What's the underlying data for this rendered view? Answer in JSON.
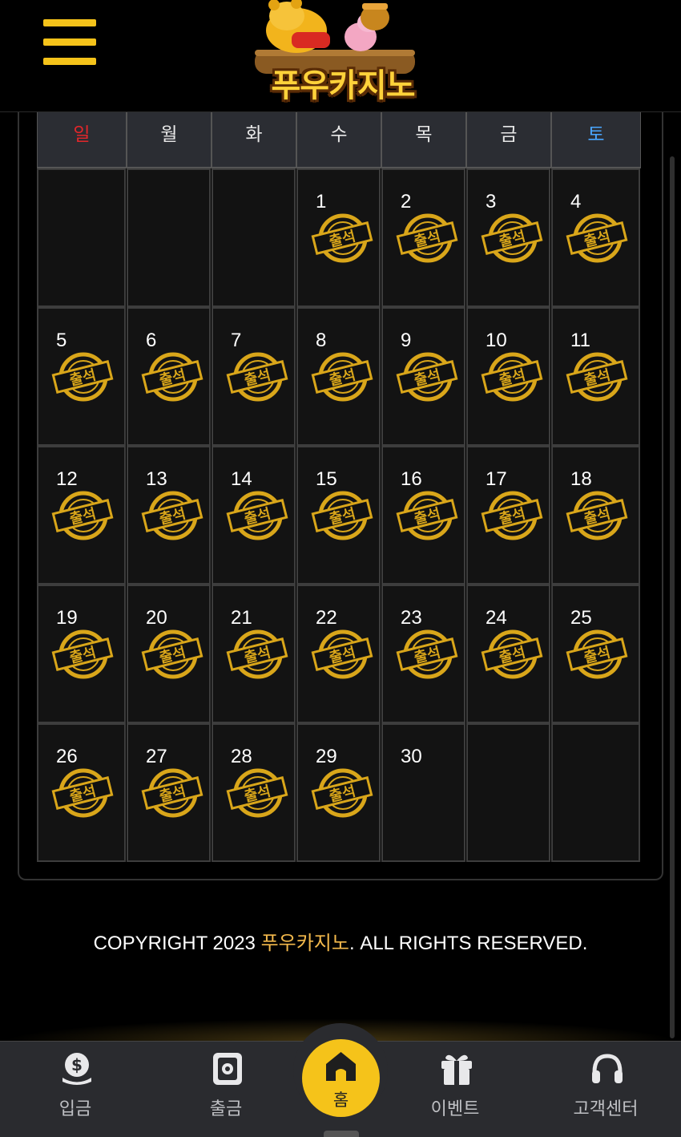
{
  "header": {
    "menu_icon": "hamburger-menu-icon",
    "logo_text": "푸우카지노"
  },
  "calendar": {
    "weekdays": [
      "일",
      "월",
      "화",
      "수",
      "목",
      "금",
      "토"
    ],
    "weekday_colors": {
      "sun": "#e2262a",
      "sat": "#4aa6ff",
      "default": "#e8e8e8"
    },
    "stamp_text": "출석",
    "stamp_color": "#d9a61a",
    "leading_blanks": 3,
    "days": [
      {
        "day": "1",
        "attended": true
      },
      {
        "day": "2",
        "attended": true
      },
      {
        "day": "3",
        "attended": true
      },
      {
        "day": "4",
        "attended": true
      },
      {
        "day": "5",
        "attended": true
      },
      {
        "day": "6",
        "attended": true
      },
      {
        "day": "7",
        "attended": true
      },
      {
        "day": "8",
        "attended": true
      },
      {
        "day": "9",
        "attended": true
      },
      {
        "day": "10",
        "attended": true
      },
      {
        "day": "11",
        "attended": true
      },
      {
        "day": "12",
        "attended": true
      },
      {
        "day": "13",
        "attended": true
      },
      {
        "day": "14",
        "attended": true
      },
      {
        "day": "15",
        "attended": true
      },
      {
        "day": "16",
        "attended": true
      },
      {
        "day": "17",
        "attended": true
      },
      {
        "day": "18",
        "attended": true
      },
      {
        "day": "19",
        "attended": true
      },
      {
        "day": "20",
        "attended": true
      },
      {
        "day": "21",
        "attended": true
      },
      {
        "day": "22",
        "attended": true
      },
      {
        "day": "23",
        "attended": true
      },
      {
        "day": "24",
        "attended": true
      },
      {
        "day": "25",
        "attended": true
      },
      {
        "day": "26",
        "attended": true
      },
      {
        "day": "27",
        "attended": true
      },
      {
        "day": "28",
        "attended": true
      },
      {
        "day": "29",
        "attended": true
      },
      {
        "day": "30",
        "attended": false
      }
    ],
    "trailing_blanks": 2
  },
  "footer": {
    "copyright_prefix": "COPYRIGHT 2023 ",
    "copyright_brand": "푸우카지노",
    "copyright_suffix": ". ALL RIGHTS RESERVED."
  },
  "bottom_nav": {
    "deposit": {
      "label": "입금",
      "icon": "dollar-coin-icon"
    },
    "withdraw": {
      "label": "출금",
      "icon": "safe-icon"
    },
    "home": {
      "label": "홈",
      "icon": "home-icon"
    },
    "event": {
      "label": "이벤트",
      "icon": "gift-icon"
    },
    "support": {
      "label": "고객센터",
      "icon": "headset-icon"
    },
    "accent_color": "#f5c31a"
  }
}
